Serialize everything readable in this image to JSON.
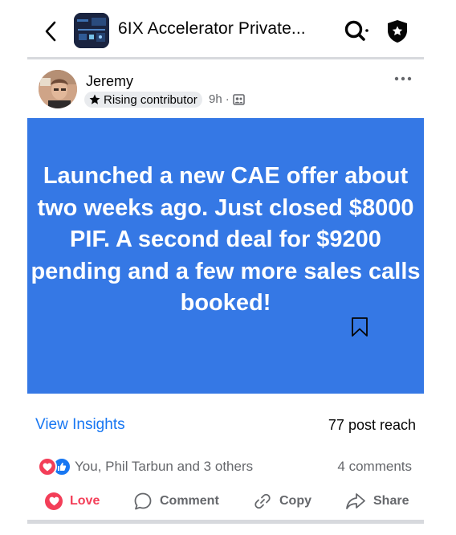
{
  "header": {
    "group_title": "6IX Accelerator Private...",
    "icons": {
      "back": "chevron-left-icon",
      "search": "search-icon",
      "admin": "shield-star-icon"
    }
  },
  "post": {
    "author": "Jeremy",
    "badge": "Rising contributor",
    "time": "9h",
    "separator": "·",
    "text": "Launched a new CAE offer about two weeks ago. Just closed $8000 PIF. A second deal for $9200 pending and a few more sales calls booked!",
    "background_color": "#3578e5"
  },
  "insights": {
    "link": "View Insights",
    "reach": "77 post reach"
  },
  "reactions": {
    "summary": "You, Phil Tarbun and 3 others",
    "comments": "4 comments"
  },
  "actions": {
    "love": "Love",
    "comment": "Comment",
    "copy": "Copy",
    "share": "Share"
  },
  "colors": {
    "accent": "#1877f2",
    "love": "#f33e58"
  }
}
